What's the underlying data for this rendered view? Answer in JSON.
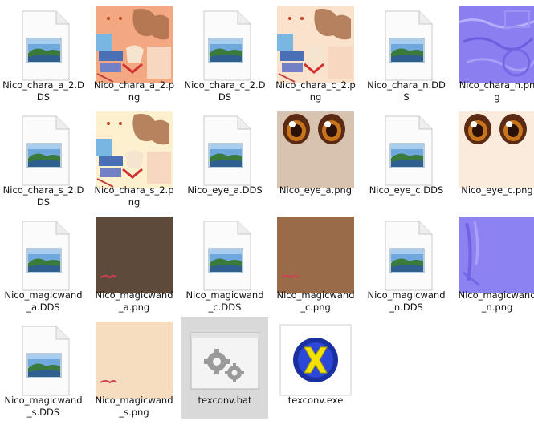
{
  "files": [
    {
      "name": "Nico_chara_a_2.DDS",
      "line1": "Nico_chara_a_2.D",
      "line2": "DS",
      "kind": "dds-file"
    },
    {
      "name": "Nico_chara_a_2.png",
      "line1": "Nico_chara_a_2.p",
      "line2": "ng",
      "kind": "chara-texture",
      "bg": "#f4a882"
    },
    {
      "name": "Nico_chara_c_2.DDS",
      "line1": "Nico_chara_c_2.D",
      "line2": "DS",
      "kind": "dds-file"
    },
    {
      "name": "Nico_chara_c_2.png",
      "line1": "Nico_chara_c_2.p",
      "line2": "ng",
      "kind": "chara-texture",
      "bg": "#fbe2cc"
    },
    {
      "name": "Nico_chara_n.DDS",
      "line1": "Nico_chara_n.DD",
      "line2": "S",
      "kind": "dds-file"
    },
    {
      "name": "Nico_chara_n.png",
      "line1": "Nico_chara_n.pn",
      "line2": "g",
      "kind": "normal-texture"
    },
    {
      "name": "Nico_chara_s_2.DDS",
      "line1": "Nico_chara_s_2.D",
      "line2": "DS",
      "kind": "dds-file"
    },
    {
      "name": "Nico_chara_s_2.png",
      "line1": "Nico_chara_s_2.p",
      "line2": "ng",
      "kind": "chara-texture",
      "bg": "#fdf0cf"
    },
    {
      "name": "Nico_eye_a.DDS",
      "line1": "Nico_eye_a.DDS",
      "line2": "",
      "kind": "dds-file"
    },
    {
      "name": "Nico_eye_a.png",
      "line1": "Nico_eye_a.png",
      "line2": "",
      "kind": "eye-texture",
      "bg": "#d8c3b0"
    },
    {
      "name": "Nico_eye_c.DDS",
      "line1": "Nico_eye_c.DDS",
      "line2": "",
      "kind": "dds-file"
    },
    {
      "name": "Nico_eye_c.png",
      "line1": "Nico_eye_c.png",
      "line2": "",
      "kind": "eye-texture",
      "bg": "#fbebdc"
    },
    {
      "name": "Nico_magicwand_a.DDS",
      "line1": "Nico_magicwand",
      "line2": "_a.DDS",
      "kind": "dds-file"
    },
    {
      "name": "Nico_magicwand_a.png",
      "line1": "Nico_magicwand",
      "line2": "_a.png",
      "kind": "wand-texture",
      "bg": "#5e4a3a"
    },
    {
      "name": "Nico_magicwand_c.DDS",
      "line1": "Nico_magicwand",
      "line2": "_c.DDS",
      "kind": "dds-file"
    },
    {
      "name": "Nico_magicwand_c.png",
      "line1": "Nico_magicwand",
      "line2": "_c.png",
      "kind": "wand-texture",
      "bg": "#9a6b48"
    },
    {
      "name": "Nico_magicwand_n.DDS",
      "line1": "Nico_magicwand",
      "line2": "_n.DDS",
      "kind": "dds-file"
    },
    {
      "name": "Nico_magicwand_n.png",
      "line1": "Nico_magicwand",
      "line2": "_n.png",
      "kind": "wand-normal"
    },
    {
      "name": "Nico_magicwand_s.DDS",
      "line1": "Nico_magicwand",
      "line2": "_s.DDS",
      "kind": "dds-file"
    },
    {
      "name": "Nico_magicwand_s.png",
      "line1": "Nico_magicwand",
      "line2": "_s.png",
      "kind": "wand-texture",
      "bg": "#f7ddc0"
    },
    {
      "name": "texconv.bat",
      "line1": "texconv.bat",
      "line2": "",
      "kind": "batch-file",
      "selected": true
    },
    {
      "name": "texconv.exe",
      "line1": "texconv.exe",
      "line2": "",
      "kind": "directx-exe"
    }
  ]
}
